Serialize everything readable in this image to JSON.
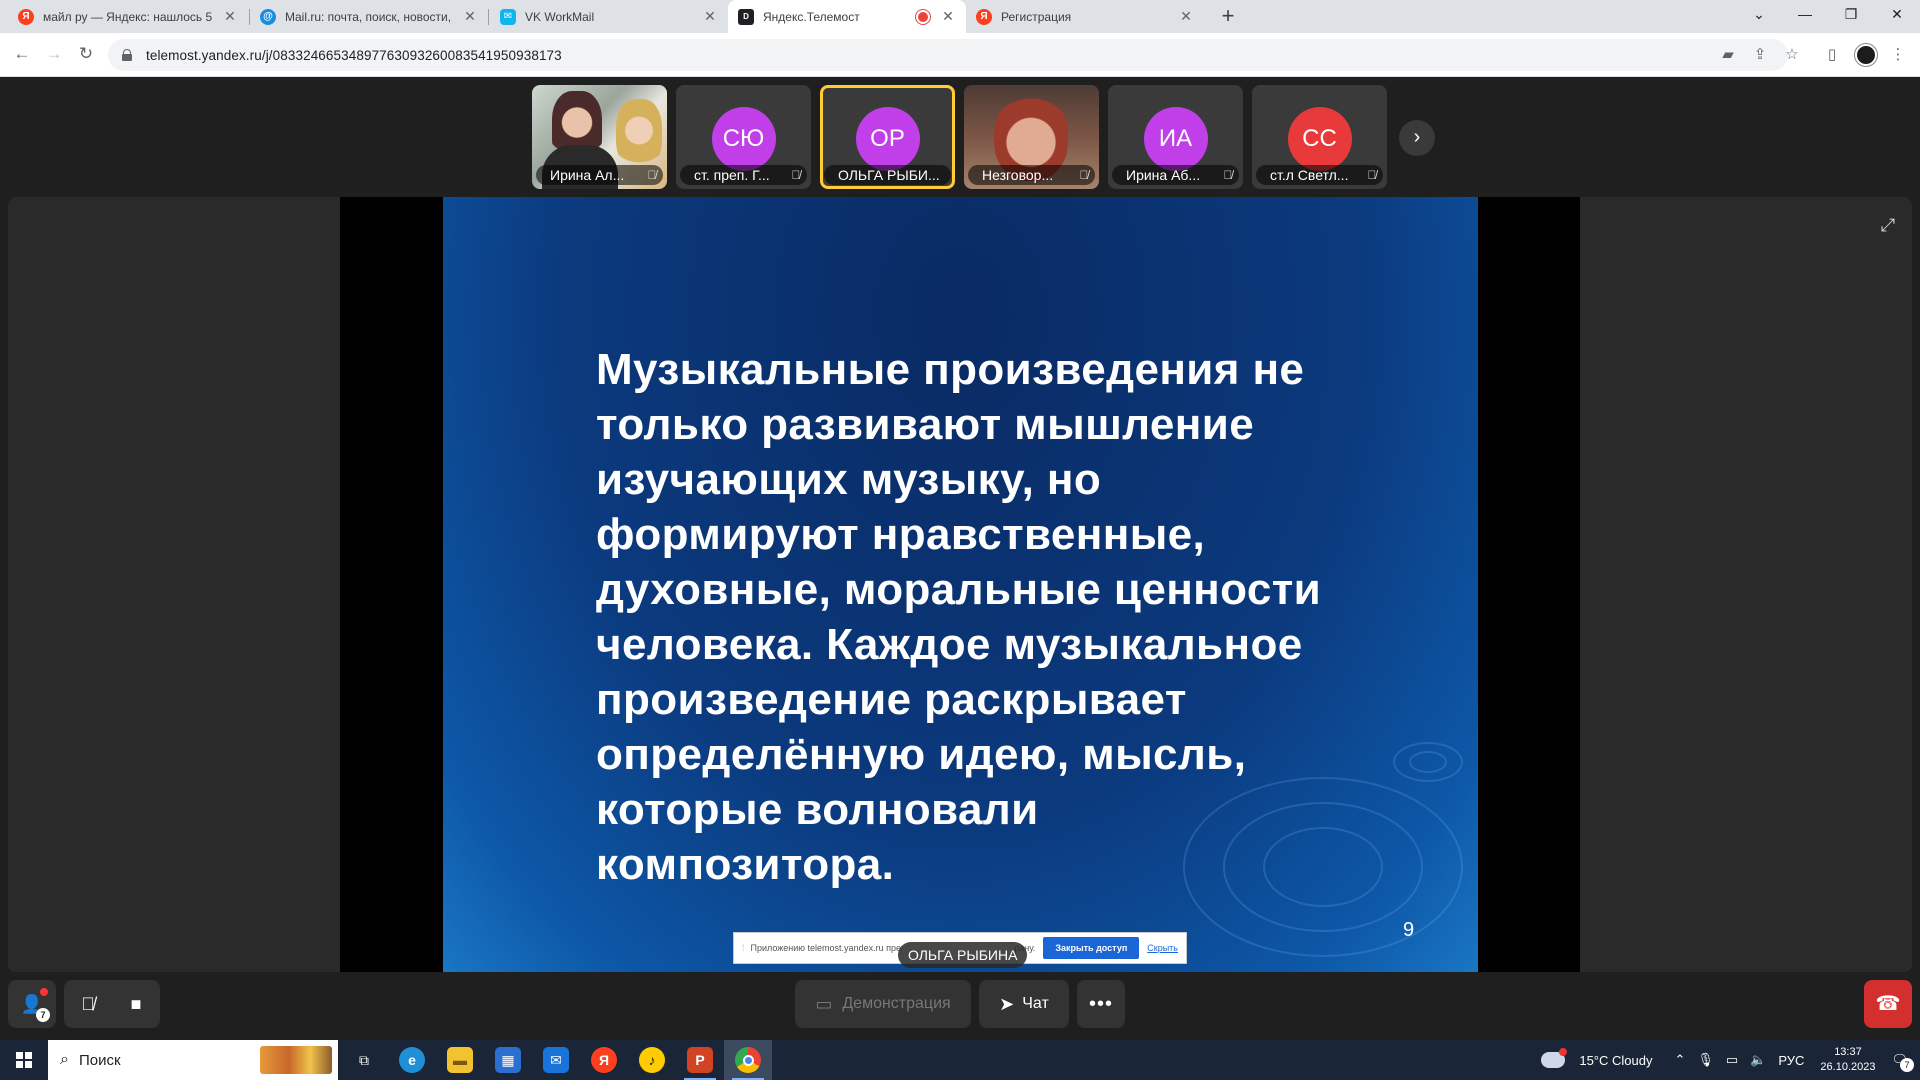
{
  "browser": {
    "tabs": [
      {
        "title": "майл ру — Яндекс: нашлось 5",
        "favicon": "yandex-icon",
        "color": "#fc3f1d",
        "active": false
      },
      {
        "title": "Mail.ru: почта, поиск, новости,",
        "favicon": "mailru-icon",
        "color": "#168de2",
        "active": false
      },
      {
        "title": "VK WorkMail",
        "favicon": "vk-workmail-icon",
        "color": "#0fb5ee",
        "active": false
      },
      {
        "title": "Яндекс.Телемост",
        "favicon": "telemost-icon",
        "color": "#202124",
        "active": true,
        "recording": true
      },
      {
        "title": "Регистрация",
        "favicon": "yandex-icon",
        "color": "#fc3f1d",
        "active": false
      }
    ],
    "url": "telemost.yandex.ru/j/08332466534897763093260083541950938173"
  },
  "participants": [
    {
      "name": "Ирина Ал...",
      "initials": "",
      "type": "video-1",
      "active": false,
      "muted": true
    },
    {
      "name": "ст. преп. Г...",
      "initials": "СЮ",
      "avatar_color": "#c03fe8",
      "active": false,
      "muted": true
    },
    {
      "name": "ОЛЬГА РЫБИ...",
      "initials": "ОР",
      "avatar_color": "#c03fe8",
      "active": true,
      "muted": false
    },
    {
      "name": "Незговор...",
      "initials": "",
      "type": "video-2",
      "active": false,
      "muted": true
    },
    {
      "name": "Ирина Аб...",
      "initials": "ИА",
      "avatar_color": "#c03fe8",
      "active": false,
      "muted": true
    },
    {
      "name": "ст.л Светл...",
      "initials": "СС",
      "avatar_color": "#e83a3a",
      "active": false,
      "muted": true
    }
  ],
  "slide": {
    "text": "Музыкальные  произведения  не\nтолько  развивают  мышление\nизучающих  музыку, но\nформируют  нравственные,\nдуховные, моральные  ценности\nчеловека. Каждое  музыкальное\nпроизведение   раскрывает\nопределённую  идею,  мысль,\nкоторые  волновали\nкомпозитора.",
    "page_number": "9"
  },
  "share_banner": {
    "text": "Приложению telemost.yandex.ru пре",
    "text_tail": "рану.",
    "close_access_label": "Закрыть доступ",
    "hide_label": "Скрыть"
  },
  "speaker_name": "ОЛЬГА РЫБИНА",
  "controls": {
    "add_participants_count": "7",
    "demo_label": "Демонстрация",
    "chat_label": "Чат"
  },
  "taskbar": {
    "search_placeholder": "Поиск",
    "weather": "15°C  Cloudy",
    "language": "РУС",
    "time": "13:37",
    "date": "26.10.2023",
    "notifications": "7"
  }
}
